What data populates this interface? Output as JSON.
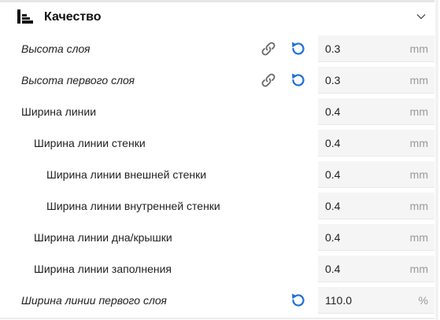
{
  "section": {
    "title": "Качество",
    "icon": "quality-settings-icon",
    "collapse_icon": "chevron-down-icon"
  },
  "colors": {
    "accent_blue": "#1e6fd9",
    "field_bg": "#f5f5f5",
    "unit_gray": "#999999"
  },
  "settings": [
    {
      "label": "Высота слоя",
      "value": "0.3",
      "unit": "mm",
      "linked": true,
      "resettable": true,
      "overridden": true
    },
    {
      "label": "Высота первого слоя",
      "value": "0.3",
      "unit": "mm",
      "linked": true,
      "resettable": true,
      "overridden": true
    },
    {
      "label": "Ширина линии",
      "value": "0.4",
      "unit": "mm",
      "linked": false,
      "resettable": false,
      "overridden": false
    },
    {
      "label": "Ширина линии стенки",
      "value": "0.4",
      "unit": "mm",
      "linked": false,
      "resettable": false,
      "overridden": false
    },
    {
      "label": "Ширина линии внешней стенки",
      "value": "0.4",
      "unit": "mm",
      "linked": false,
      "resettable": false,
      "overridden": false
    },
    {
      "label": "Ширина линии внутренней стенки",
      "value": "0.4",
      "unit": "mm",
      "linked": false,
      "resettable": false,
      "overridden": false
    },
    {
      "label": "Ширина линии дна/крышки",
      "value": "0.4",
      "unit": "mm",
      "linked": false,
      "resettable": false,
      "overridden": false
    },
    {
      "label": "Ширина линии заполнения",
      "value": "0.4",
      "unit": "mm",
      "linked": false,
      "resettable": false,
      "overridden": false
    },
    {
      "label": "Ширина линии первого слоя",
      "value": "110.0",
      "unit": "%",
      "linked": false,
      "resettable": true,
      "overridden": true
    }
  ]
}
